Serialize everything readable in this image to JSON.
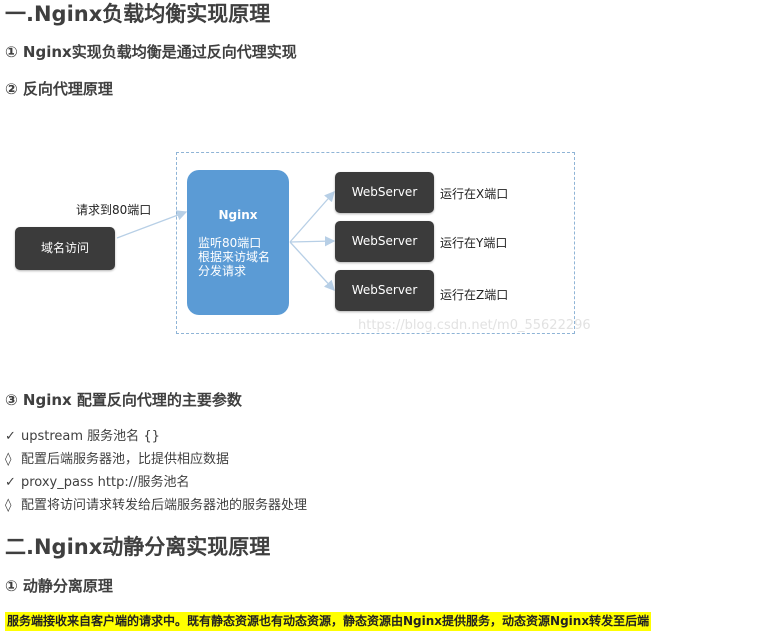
{
  "section1": {
    "title": "一.Nginx负载均衡实现原理",
    "item1": "① Nginx实现负载均衡是通过反向代理实现",
    "item2": "② 反向代理原理",
    "item3": "③ Nginx 配置反向代理的主要参数"
  },
  "diagram": {
    "request_label": "请求到80端口",
    "client_label": "域名访问",
    "nginx_title": "Nginx",
    "nginx_desc": [
      "监听80端口",
      "根据来访域名",
      "分发请求"
    ],
    "servers": [
      {
        "label": "WebServer",
        "note": "运行在X端口"
      },
      {
        "label": "WebServer",
        "note": "运行在Y端口"
      },
      {
        "label": "WebServer",
        "note": "运行在Z端口"
      }
    ],
    "watermark": "https://blog.csdn.net/m0_55622296",
    "colors": {
      "nginx_fill": "#5b9bd5",
      "dark_box": "#3b3b3b",
      "frame": "#8fb4d6"
    }
  },
  "params": [
    {
      "mark": "✓",
      "text": "upstream 服务池名 {}"
    },
    {
      "mark": "◊",
      "text": "配置后端服务器池，比提供相应数据"
    },
    {
      "mark": "✓",
      "text": "proxy_pass http://服务池名"
    },
    {
      "mark": "◊",
      "text": "配置将访问请求转发给后端服务器池的服务器处理"
    }
  ],
  "section2": {
    "title": "二.Nginx动静分离实现原理",
    "item1": "① 动静分离原理",
    "highlight": "服务端接收来自客户端的请求中。既有静态资源也有动态资源，静态资源由Nginx提供服务，动态资源Nginx转发至后端",
    "highlight_color": "#ffff00"
  }
}
